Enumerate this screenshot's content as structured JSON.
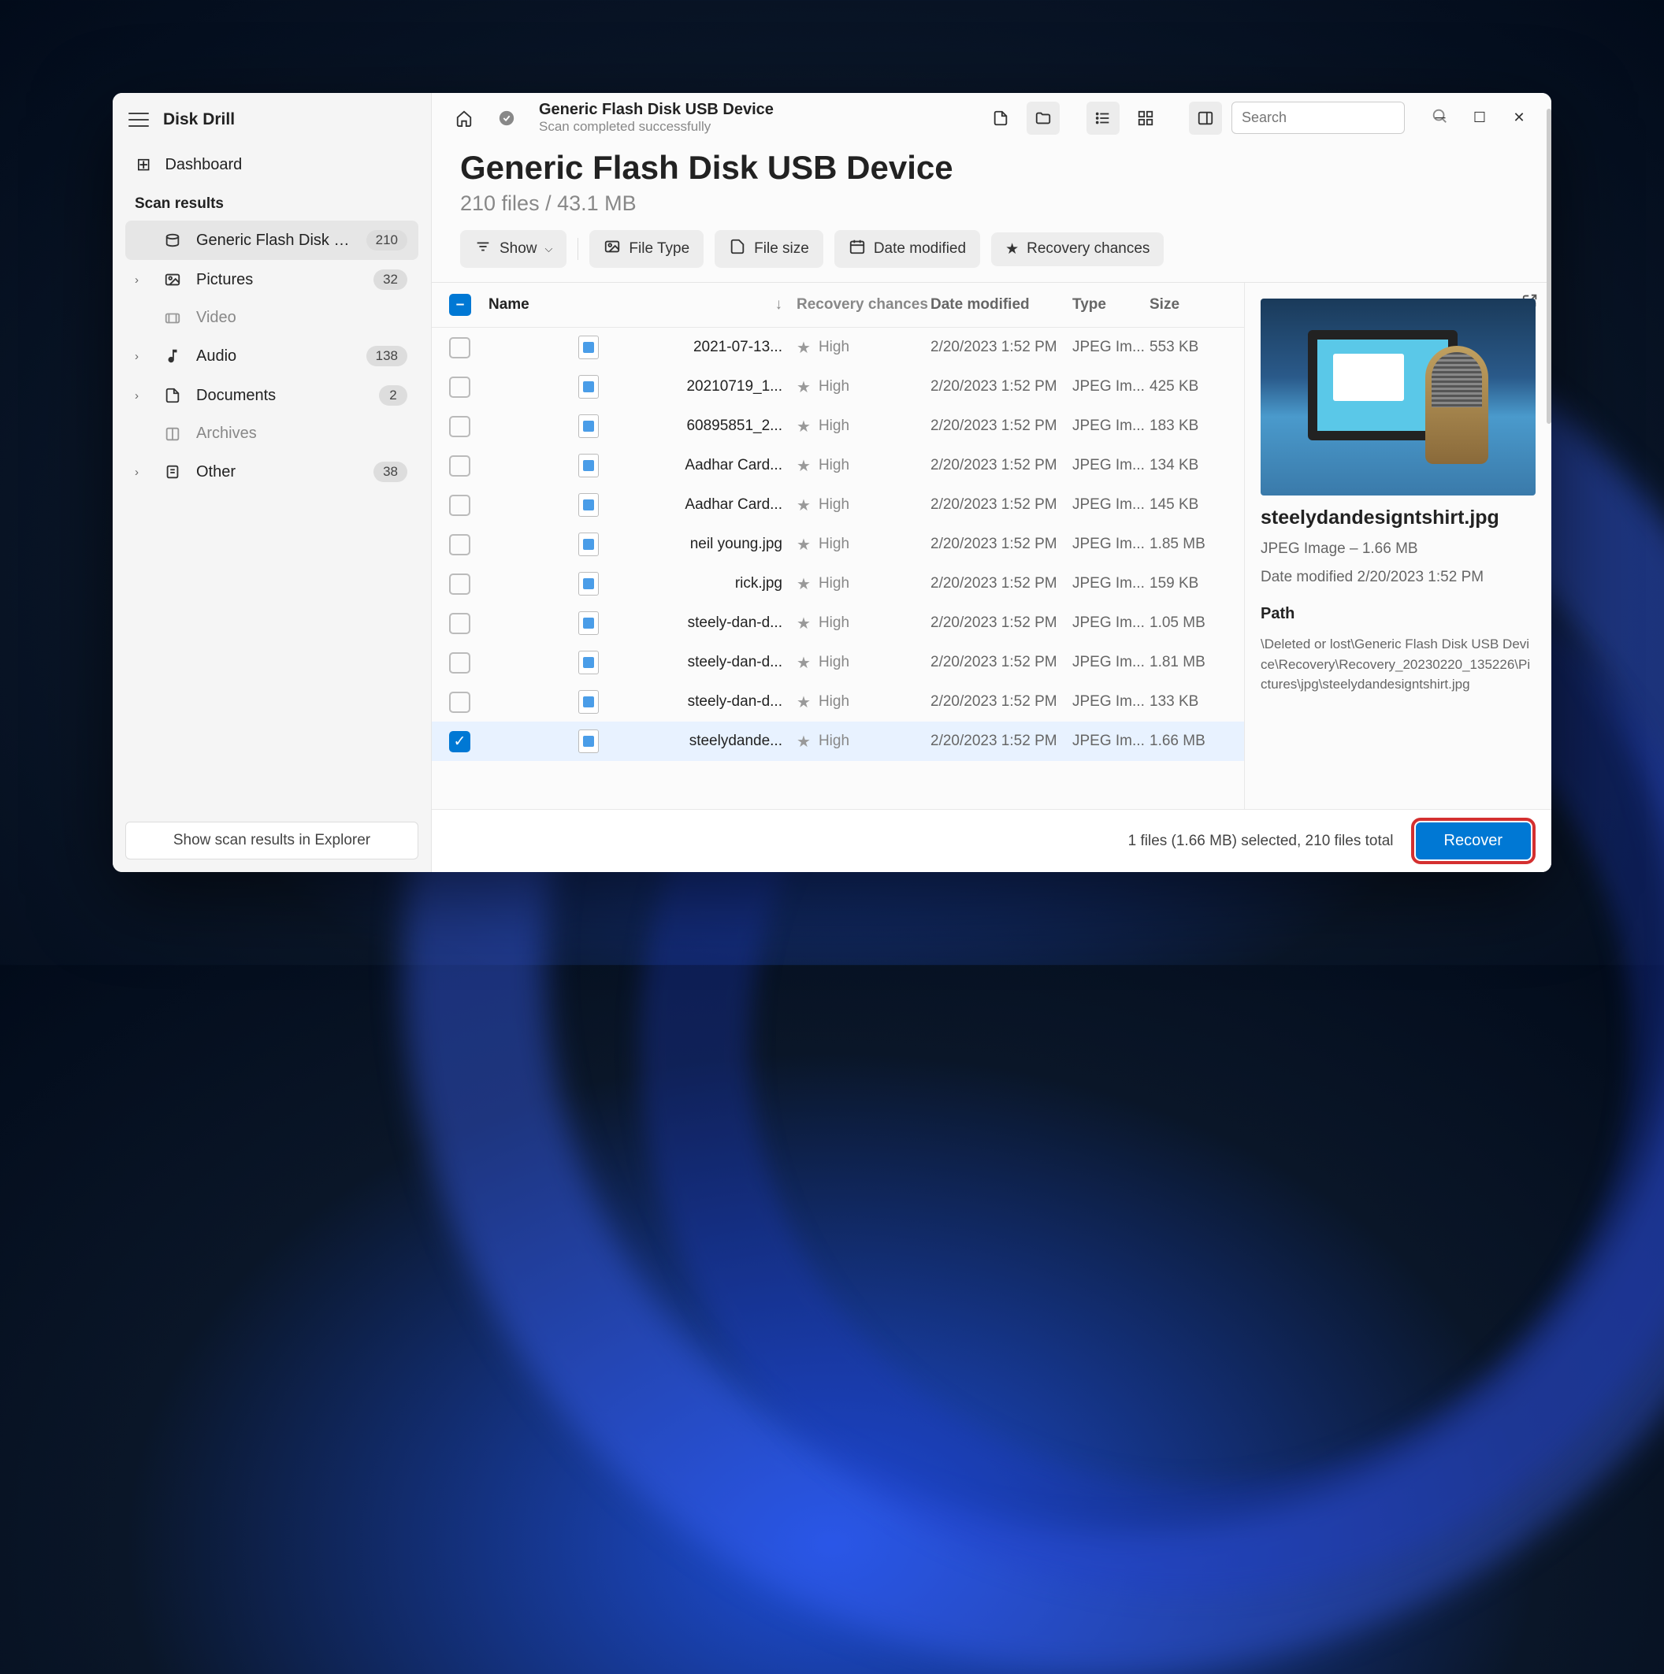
{
  "app": {
    "name": "Disk Drill"
  },
  "sidebar": {
    "dashboard": "Dashboard",
    "scan_results_heading": "Scan results",
    "items": [
      {
        "label": "Generic Flash Disk USB...",
        "badge": "210",
        "active": true,
        "icon": "disk"
      },
      {
        "label": "Pictures",
        "badge": "32",
        "icon": "picture",
        "expandable": true
      },
      {
        "label": "Video",
        "icon": "video",
        "child": true
      },
      {
        "label": "Audio",
        "badge": "138",
        "icon": "audio",
        "expandable": true
      },
      {
        "label": "Documents",
        "badge": "2",
        "icon": "document",
        "expandable": true
      },
      {
        "label": "Archives",
        "icon": "archive",
        "child": true
      },
      {
        "label": "Other",
        "badge": "38",
        "icon": "other",
        "expandable": true
      }
    ],
    "footer_button": "Show scan results in Explorer"
  },
  "toolbar": {
    "title": "Generic Flash Disk USB Device",
    "subtitle": "Scan completed successfully",
    "search_placeholder": "Search"
  },
  "header": {
    "device_title": "Generic Flash Disk USB Device",
    "device_sub": "210 files / 43.1 MB"
  },
  "filters": {
    "show": "Show",
    "file_type": "File Type",
    "file_size": "File size",
    "date_modified": "Date modified",
    "recovery_chances": "Recovery chances"
  },
  "table": {
    "columns": {
      "name": "Name",
      "recovery": "Recovery chances",
      "date": "Date modified",
      "type": "Type",
      "size": "Size"
    },
    "rows": [
      {
        "name": "2021-07-13...",
        "recovery": "High",
        "date": "2/20/2023 1:52 PM",
        "type": "JPEG Im...",
        "size": "553 KB",
        "checked": false
      },
      {
        "name": "20210719_1...",
        "recovery": "High",
        "date": "2/20/2023 1:52 PM",
        "type": "JPEG Im...",
        "size": "425 KB",
        "checked": false
      },
      {
        "name": "60895851_2...",
        "recovery": "High",
        "date": "2/20/2023 1:52 PM",
        "type": "JPEG Im...",
        "size": "183 KB",
        "checked": false
      },
      {
        "name": "Aadhar Card...",
        "recovery": "High",
        "date": "2/20/2023 1:52 PM",
        "type": "JPEG Im...",
        "size": "134 KB",
        "checked": false
      },
      {
        "name": "Aadhar Card...",
        "recovery": "High",
        "date": "2/20/2023 1:52 PM",
        "type": "JPEG Im...",
        "size": "145 KB",
        "checked": false
      },
      {
        "name": "neil young.jpg",
        "recovery": "High",
        "date": "2/20/2023 1:52 PM",
        "type": "JPEG Im...",
        "size": "1.85 MB",
        "checked": false
      },
      {
        "name": "rick.jpg",
        "recovery": "High",
        "date": "2/20/2023 1:52 PM",
        "type": "JPEG Im...",
        "size": "159 KB",
        "checked": false
      },
      {
        "name": "steely-dan-d...",
        "recovery": "High",
        "date": "2/20/2023 1:52 PM",
        "type": "JPEG Im...",
        "size": "1.05 MB",
        "checked": false
      },
      {
        "name": "steely-dan-d...",
        "recovery": "High",
        "date": "2/20/2023 1:52 PM",
        "type": "JPEG Im...",
        "size": "1.81 MB",
        "checked": false
      },
      {
        "name": "steely-dan-d...",
        "recovery": "High",
        "date": "2/20/2023 1:52 PM",
        "type": "JPEG Im...",
        "size": "133 KB",
        "checked": false
      },
      {
        "name": "steelydande...",
        "recovery": "High",
        "date": "2/20/2023 1:52 PM",
        "type": "JPEG Im...",
        "size": "1.66 MB",
        "checked": true
      }
    ]
  },
  "preview": {
    "filename": "steelydandesigntshirt.jpg",
    "meta_line": "JPEG Image – 1.66 MB",
    "date_line": "Date modified 2/20/2023 1:52 PM",
    "path_heading": "Path",
    "path": "\\Deleted or lost\\Generic Flash Disk USB Device\\Recovery\\Recovery_20230220_135226\\Pictures\\jpg\\steelydandesigntshirt.jpg"
  },
  "footer": {
    "status": "1 files (1.66 MB) selected, 210 files total",
    "recover": "Recover"
  }
}
